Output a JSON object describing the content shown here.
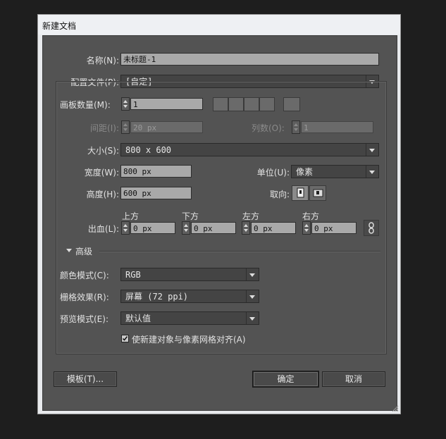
{
  "window": {
    "title": "新建文档"
  },
  "name_label": "名称(N):",
  "name_value": "未标题-1",
  "profile_label": "配置文件(P):",
  "profile_value": "[自定]",
  "artboards": {
    "count_label": "画板数量(M):",
    "count_value": "1",
    "spacing_label": "间距(I):",
    "spacing_value": "20 px",
    "columns_label": "列数(O):",
    "columns_value": "1"
  },
  "size_label": "大小(S):",
  "size_value": "800 x 600",
  "width_label": "宽度(W):",
  "width_value": "800 px",
  "units_label": "单位(U):",
  "units_value": "像素",
  "height_label": "高度(H):",
  "height_value": "600 px",
  "orientation_label": "取向:",
  "bleed": {
    "label": "出血(L):",
    "top_label": "上方",
    "top_value": "0 px",
    "bottom_label": "下方",
    "bottom_value": "0 px",
    "left_label": "左方",
    "left_value": "0 px",
    "right_label": "右方",
    "right_value": "0 px"
  },
  "advanced_label": "高级",
  "color_mode_label": "颜色模式(C):",
  "color_mode_value": "RGB",
  "raster_label": "栅格效果(R):",
  "raster_value": "屏幕 (72 ppi)",
  "preview_label": "预览模式(E):",
  "preview_value": "默认值",
  "align_checkbox_label": "使新建对象与像素网格对齐(A)",
  "buttons": {
    "templates": "模板(T)...",
    "ok": "确定",
    "cancel": "取消"
  }
}
